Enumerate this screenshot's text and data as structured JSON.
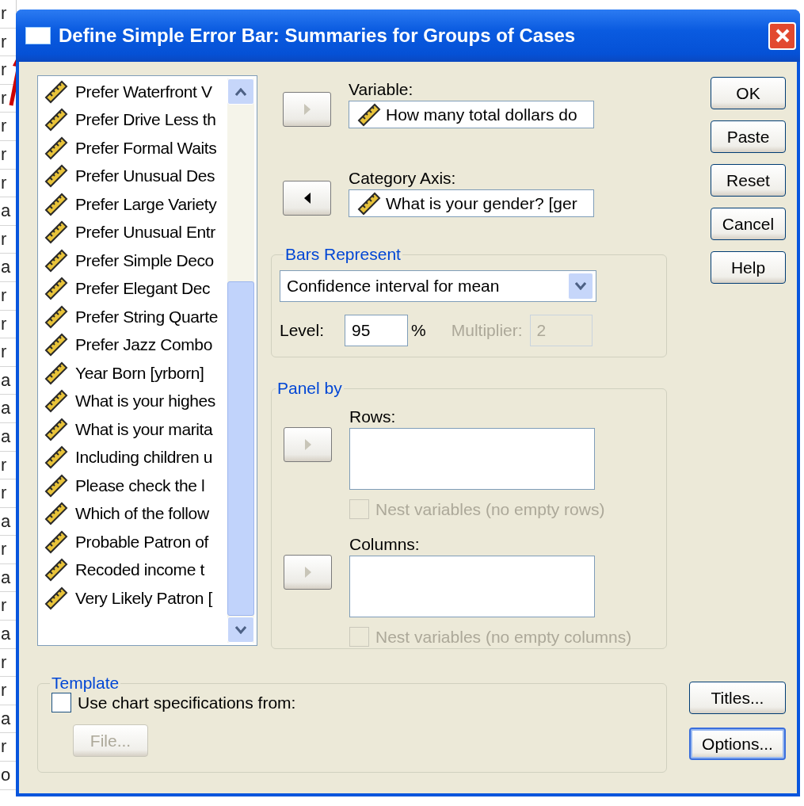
{
  "background_sheet": {
    "row_fragments": [
      "r",
      "r",
      "r",
      "r",
      "r",
      "r",
      "r",
      "a",
      "r",
      "a",
      "r",
      "r",
      "r",
      "a",
      "a",
      "a",
      "r",
      "r",
      "a",
      "r",
      "a",
      "r",
      "a",
      "r",
      "r",
      "a",
      "r",
      "o"
    ]
  },
  "window": {
    "title": "Define Simple Error Bar: Summaries for Groups of Cases"
  },
  "variable_list": {
    "items": [
      {
        "label": "Prefer Waterfront V"
      },
      {
        "label": "Prefer Drive Less th"
      },
      {
        "label": "Prefer Formal Waits"
      },
      {
        "label": "Prefer Unusual Des"
      },
      {
        "label": "Prefer Large Variety"
      },
      {
        "label": "Prefer Unusual Entr"
      },
      {
        "label": "Prefer Simple Deco"
      },
      {
        "label": "Prefer Elegant Dec"
      },
      {
        "label": "Prefer String Quarte"
      },
      {
        "label": "Prefer Jazz Combo"
      },
      {
        "label": "Year Born [yrborn]"
      },
      {
        "label": "What is your highes"
      },
      {
        "label": "What is your marita"
      },
      {
        "label": "Including children u"
      },
      {
        "label": "Please check the l"
      },
      {
        "label": "Which of the follow"
      },
      {
        "label": "Probable Patron of"
      },
      {
        "label": "Recoded income t"
      },
      {
        "label": "Very Likely Patron ["
      }
    ]
  },
  "variable": {
    "label": "Variable:",
    "value": "How many total dollars do",
    "arrow": {
      "kind": "right",
      "disabled": true
    }
  },
  "category_axis": {
    "label": "Category Axis:",
    "value": "What is your gender? [ger",
    "arrow": {
      "kind": "left",
      "disabled": false
    }
  },
  "bars_represent": {
    "title": "Bars Represent",
    "dropdown": "Confidence interval for mean",
    "level_label": "Level:",
    "level_value": "95",
    "percent": "%",
    "multiplier_label": "Multiplier:",
    "multiplier_value": "2",
    "multiplier_disabled": true
  },
  "panel_by": {
    "title": "Panel by",
    "rows": {
      "label": "Rows:",
      "arrow": {
        "kind": "right",
        "disabled": true
      },
      "nest": {
        "label": "Nest variables (no empty rows)",
        "checked": false,
        "disabled": true
      }
    },
    "columns": {
      "label": "Columns:",
      "arrow": {
        "kind": "right",
        "disabled": true
      },
      "nest": {
        "label": "Nest variables (no empty columns)",
        "checked": false,
        "disabled": true
      }
    }
  },
  "template": {
    "title": "Template",
    "checkbox": {
      "label": "Use chart specifications from:",
      "checked": false,
      "disabled": false
    },
    "file_button": {
      "label": "File...",
      "disabled": true
    }
  },
  "buttons": [
    {
      "label": "OK",
      "focused": false
    },
    {
      "label": "Paste",
      "focused": false
    },
    {
      "label": "Reset",
      "focused": false
    },
    {
      "label": "Cancel",
      "focused": false
    },
    {
      "label": "Help",
      "focused": false
    }
  ],
  "bottom_buttons": [
    {
      "label": "Titles...",
      "focused": false
    },
    {
      "label": "Options...",
      "focused": true
    }
  ]
}
